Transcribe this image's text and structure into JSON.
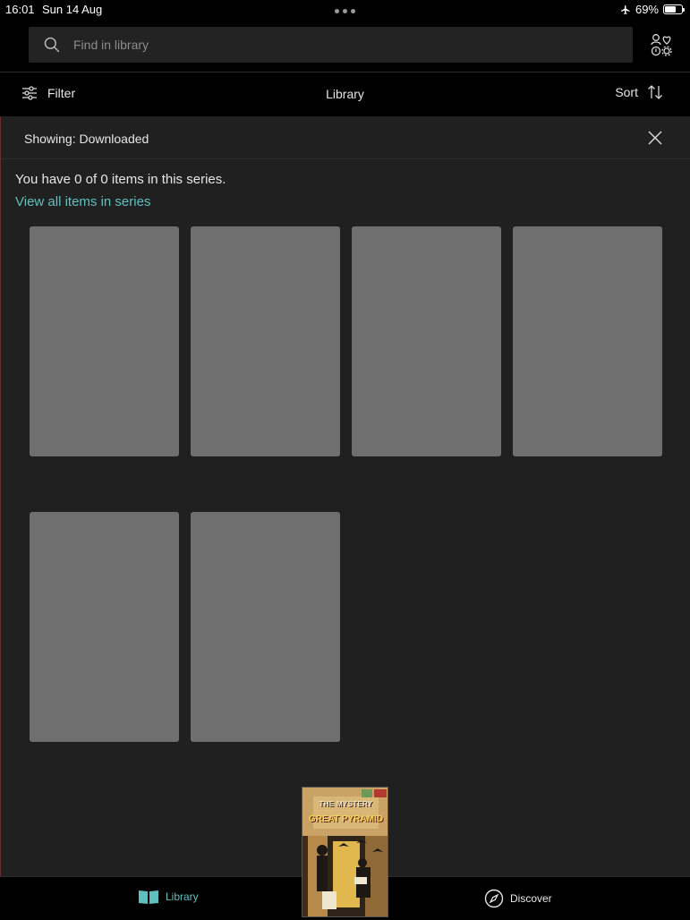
{
  "status_bar": {
    "time": "16:01",
    "date": "Sun 14 Aug",
    "battery_percent": "69%",
    "battery_level": 0.69
  },
  "search": {
    "placeholder": "Find in library"
  },
  "toolbar": {
    "filter_label": "Filter",
    "title": "Library",
    "sort_label": "Sort"
  },
  "filter_banner": {
    "label": "Showing: Downloaded"
  },
  "series": {
    "count_text": "You have 0 of 0 items in this series.",
    "view_all_link": "View all items in series"
  },
  "grid": {
    "tiles": [
      {},
      {},
      {},
      {},
      {},
      {}
    ]
  },
  "now_reading": {
    "title_line_1": "THE MYSTERY",
    "title_line_2": "GREAT PYRAMID"
  },
  "bottom_nav": {
    "items": [
      {
        "label": "Library",
        "icon": "book-icon",
        "active": true
      },
      {
        "label": "Discover",
        "icon": "compass-icon",
        "active": false
      }
    ]
  },
  "colors": {
    "accent": "#5fc0c0",
    "background": "#202020",
    "placeholder_tile": "#6f6f6f"
  }
}
